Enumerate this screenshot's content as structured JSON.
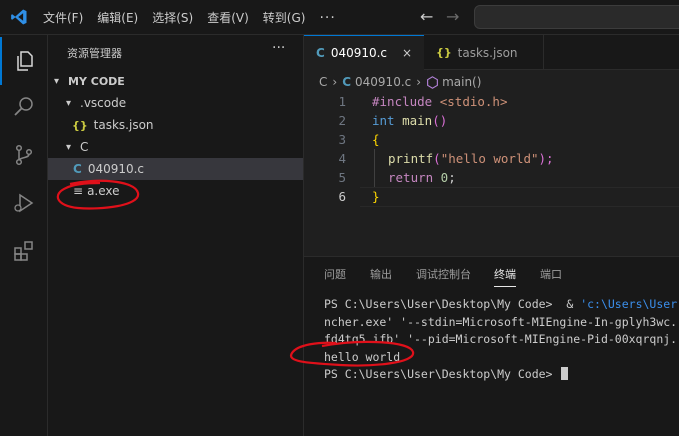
{
  "menu": {
    "items": [
      "文件(F)",
      "编辑(E)",
      "选择(S)",
      "查看(V)",
      "转到(G)"
    ],
    "more": "···"
  },
  "nav": {
    "back": "←",
    "forward": "→"
  },
  "sidebar": {
    "title": "资源管理器",
    "more": "···",
    "root": "MY CODE",
    "items": [
      {
        "label": ".vscode"
      },
      {
        "label": "tasks.json"
      },
      {
        "label": "C"
      },
      {
        "label": "040910.c"
      },
      {
        "label": "a.exe"
      }
    ]
  },
  "icons": {
    "json": "{}",
    "c": "C",
    "exe": "≡"
  },
  "tabs": [
    {
      "label": "040910.c",
      "close": "×"
    },
    {
      "label": "tasks.json"
    }
  ],
  "breadcrumb": {
    "folder": "C",
    "sep1": "›",
    "file": "040910.c",
    "sep2": "›",
    "symbol": "main()"
  },
  "code": {
    "line_numbers": [
      "1",
      "2",
      "3",
      "4",
      "5",
      "6"
    ],
    "l1_directive": "#include",
    "l1_header": " <stdio.h>",
    "l2_type": "int",
    "l2_name": " main",
    "l2_parens": "()",
    "l3": "{",
    "l4_fn": "printf",
    "l4_open": "(",
    "l4_str": "\"hello world\"",
    "l4_close": ");",
    "l5_kw": "return",
    "l5_num": " 0",
    "l5_semi": ";",
    "l6": "}"
  },
  "panel": {
    "tabs": [
      "问题",
      "输出",
      "调试控制台",
      "终端",
      "端口"
    ],
    "active_tab": "终端"
  },
  "terminal": {
    "line1_prompt": "PS C:\\Users\\User\\Desktop\\My Code>  & ",
    "line1_path": "'c:\\Users\\User",
    "line2": "ncher.exe' '--stdin=Microsoft-MIEngine-In-gplyh3wc.",
    "line3": "fd4tq5.ifb' '--pid=Microsoft-MIEngine-Pid-00xqrqnj.",
    "line4": "hello world",
    "line5": "PS C:\\Users\\User\\Desktop\\My Code> "
  },
  "colors": {
    "accent": "#0078d4",
    "annotation": "#e0101a",
    "keyword": "#569cd6",
    "preprocessor": "#c586c0",
    "string": "#ce9178",
    "function": "#dcdcaa",
    "number": "#b5cea8",
    "bracket": "#ffd700"
  }
}
